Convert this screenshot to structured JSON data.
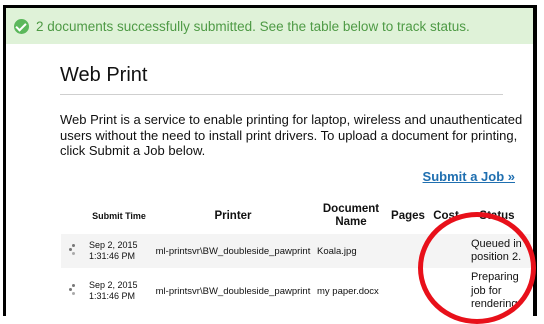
{
  "banner": {
    "text": "2 documents successfully submitted. See the table below to track status.",
    "icon": "checkmark-circle-icon",
    "color": "#4e9a45"
  },
  "page": {
    "title": "Web Print",
    "description": "Web Print is a service to enable printing for laptop, wireless and unauthenticated users without the need to install print drivers. To upload a document for printing, click Submit a Job below.",
    "submit_link": "Submit a Job »"
  },
  "table": {
    "headers": {
      "submit_time": "Submit Time",
      "printer": "Printer",
      "document_name": "Document Name",
      "pages": "Pages",
      "cost": "Cost",
      "status": "Status"
    },
    "rows": [
      {
        "submit_date": "Sep 2, 2015",
        "submit_clock": "1:31:46 PM",
        "printer": "ml-printsvr\\BW_doubleside_pawprint",
        "document": "Koala.jpg",
        "pages": "",
        "cost": "",
        "status": "Queued in position 2."
      },
      {
        "submit_date": "Sep 2, 2015",
        "submit_clock": "1:31:46 PM",
        "printer": "ml-printsvr\\BW_doubleside_pawprint",
        "document": "my paper.docx",
        "pages": "",
        "cost": "",
        "status": "Preparing job for rendering."
      }
    ]
  },
  "annotation": {
    "color": "#e8101a"
  }
}
